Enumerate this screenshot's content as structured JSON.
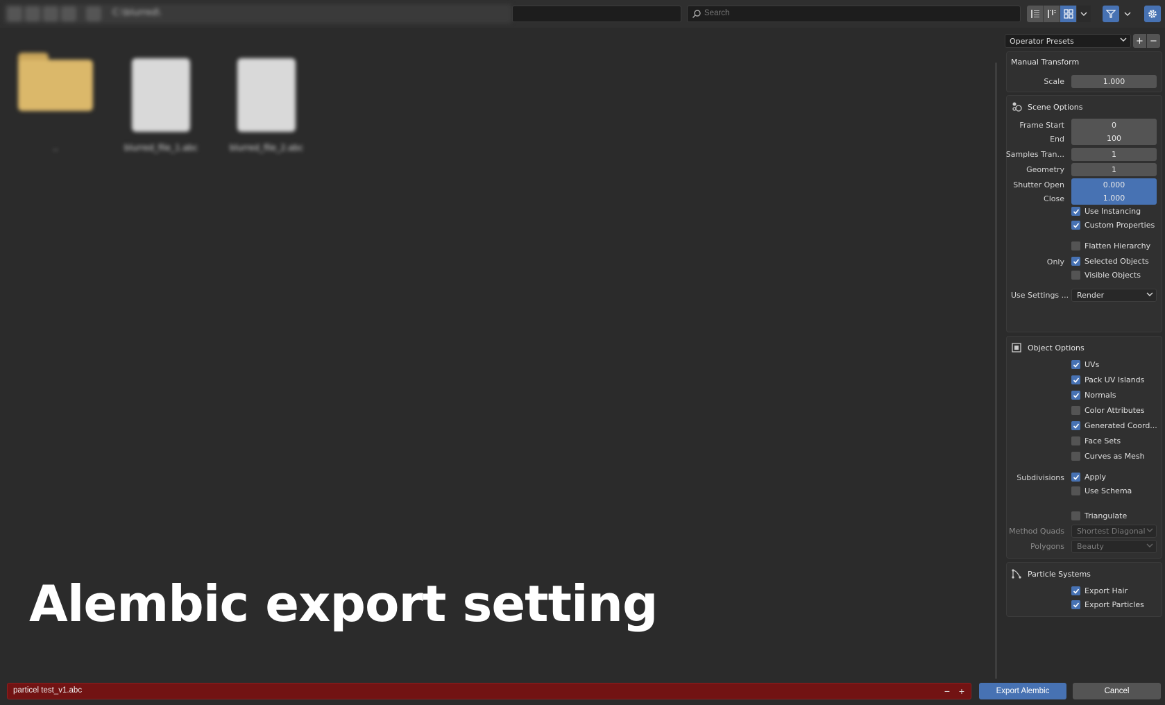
{
  "header": {
    "blurred_path": "C:\\blurred\\",
    "search_placeholder": "Search",
    "colors": {
      "accent": "#4772b3"
    }
  },
  "files": [
    {
      "type": "folder",
      "label": "..",
      "icon": "folder-icon"
    },
    {
      "type": "file",
      "label": "blurred_file_1.abc",
      "icon": "file-icon"
    },
    {
      "type": "file",
      "label": "blurred_file_2.abc",
      "icon": "file-icon"
    }
  ],
  "overlay": {
    "title": "Alembic export setting"
  },
  "sidebar": {
    "presets": "Operator Presets",
    "manual_transform": {
      "title": "Manual Transform",
      "scale_label": "Scale",
      "scale_value": "1.000"
    },
    "scene_options": {
      "title": "Scene Options",
      "frame_start_label": "Frame Start",
      "frame_start": "0",
      "end_label": "End",
      "end": "100",
      "samples_label": "Samples Tran...",
      "samples": "1",
      "geometry_label": "Geometry",
      "geometry": "1",
      "shutter_open_label": "Shutter Open",
      "shutter_open": "0.000",
      "close_label": "Close",
      "close": "1.000",
      "use_instancing": "Use Instancing",
      "custom_properties": "Custom Properties",
      "flatten_hierarchy": "Flatten Hierarchy",
      "only_label": "Only",
      "selected_objects": "Selected Objects",
      "visible_objects": "Visible Objects",
      "use_settings_label": "Use Settings ...",
      "use_settings_value": "Render"
    },
    "object_options": {
      "title": "Object Options",
      "uvs": "UVs",
      "pack_uv": "Pack UV Islands",
      "normals": "Normals",
      "color_attributes": "Color Attributes",
      "generated_coords": "Generated Coord...",
      "face_sets": "Face Sets",
      "curves_as_mesh": "Curves as Mesh",
      "subdivisions_label": "Subdivisions",
      "apply": "Apply",
      "use_schema": "Use Schema",
      "triangulate": "Triangulate",
      "method_quads_label": "Method Quads",
      "method_quads_value": "Shortest Diagonal",
      "polygons_label": "Polygons",
      "polygons_value": "Beauty"
    },
    "particle_systems": {
      "title": "Particle Systems",
      "export_hair": "Export Hair",
      "export_particles": "Export Particles"
    }
  },
  "footer": {
    "filename": "particel test_v1.abc",
    "minus": "−",
    "plus": "+",
    "export_label": "Export Alembic",
    "cancel_label": "Cancel"
  }
}
